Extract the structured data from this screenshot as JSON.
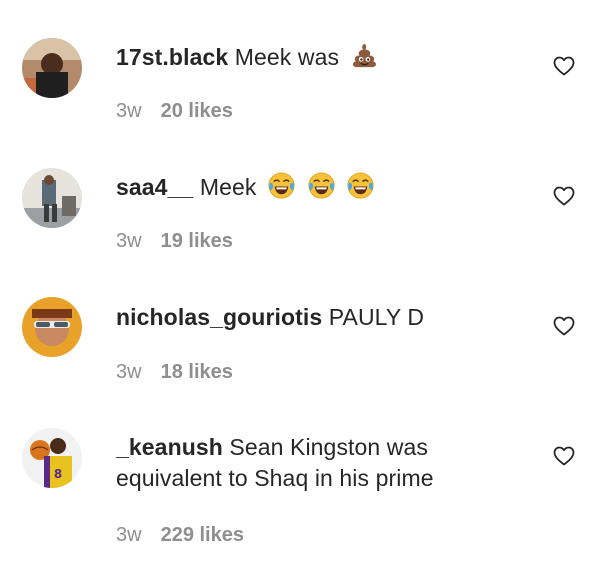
{
  "comments": [
    {
      "username": "17st.black",
      "text": "Meek was",
      "emoji": [
        "pile-of-poo"
      ],
      "time": "3w",
      "likes": "20 likes"
    },
    {
      "username": "saa4__",
      "text": "Meek",
      "emoji": [
        "tears-of-joy",
        "tears-of-joy",
        "tears-of-joy"
      ],
      "time": "3w",
      "likes": "19 likes"
    },
    {
      "username": "nicholas_gouriotis",
      "text": "PAULY D",
      "emoji": [],
      "time": "3w",
      "likes": "18 likes"
    },
    {
      "username": "_keanush",
      "text": "Sean Kingston was equivalent to Shaq in his prime",
      "emoji": [],
      "time": "3w",
      "likes": "229 likes"
    }
  ],
  "colors": {
    "text": "#262626",
    "meta": "#8e8e8e",
    "heart": "#262626"
  }
}
